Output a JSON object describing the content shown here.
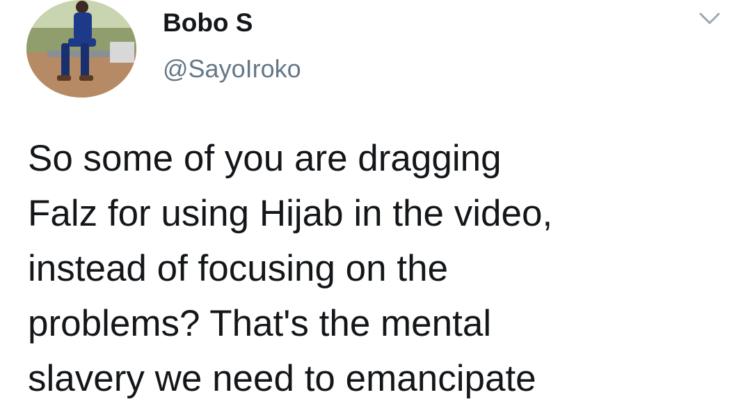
{
  "author": {
    "display_name": "Bobo S",
    "handle": "@SayoIroko",
    "avatar_icon": "avatar-photo"
  },
  "menu": {
    "icon": "chevron-down-icon",
    "color": "#9aa7b3"
  },
  "tweet": {
    "text": "So some of you are dragging\nFalz for using Hijab in the video,\ninstead of focusing on the\nproblems? That's the mental\nslavery we need to emancipate"
  },
  "colors": {
    "text_primary": "#14171a",
    "text_secondary": "#657786",
    "background": "#ffffff"
  }
}
